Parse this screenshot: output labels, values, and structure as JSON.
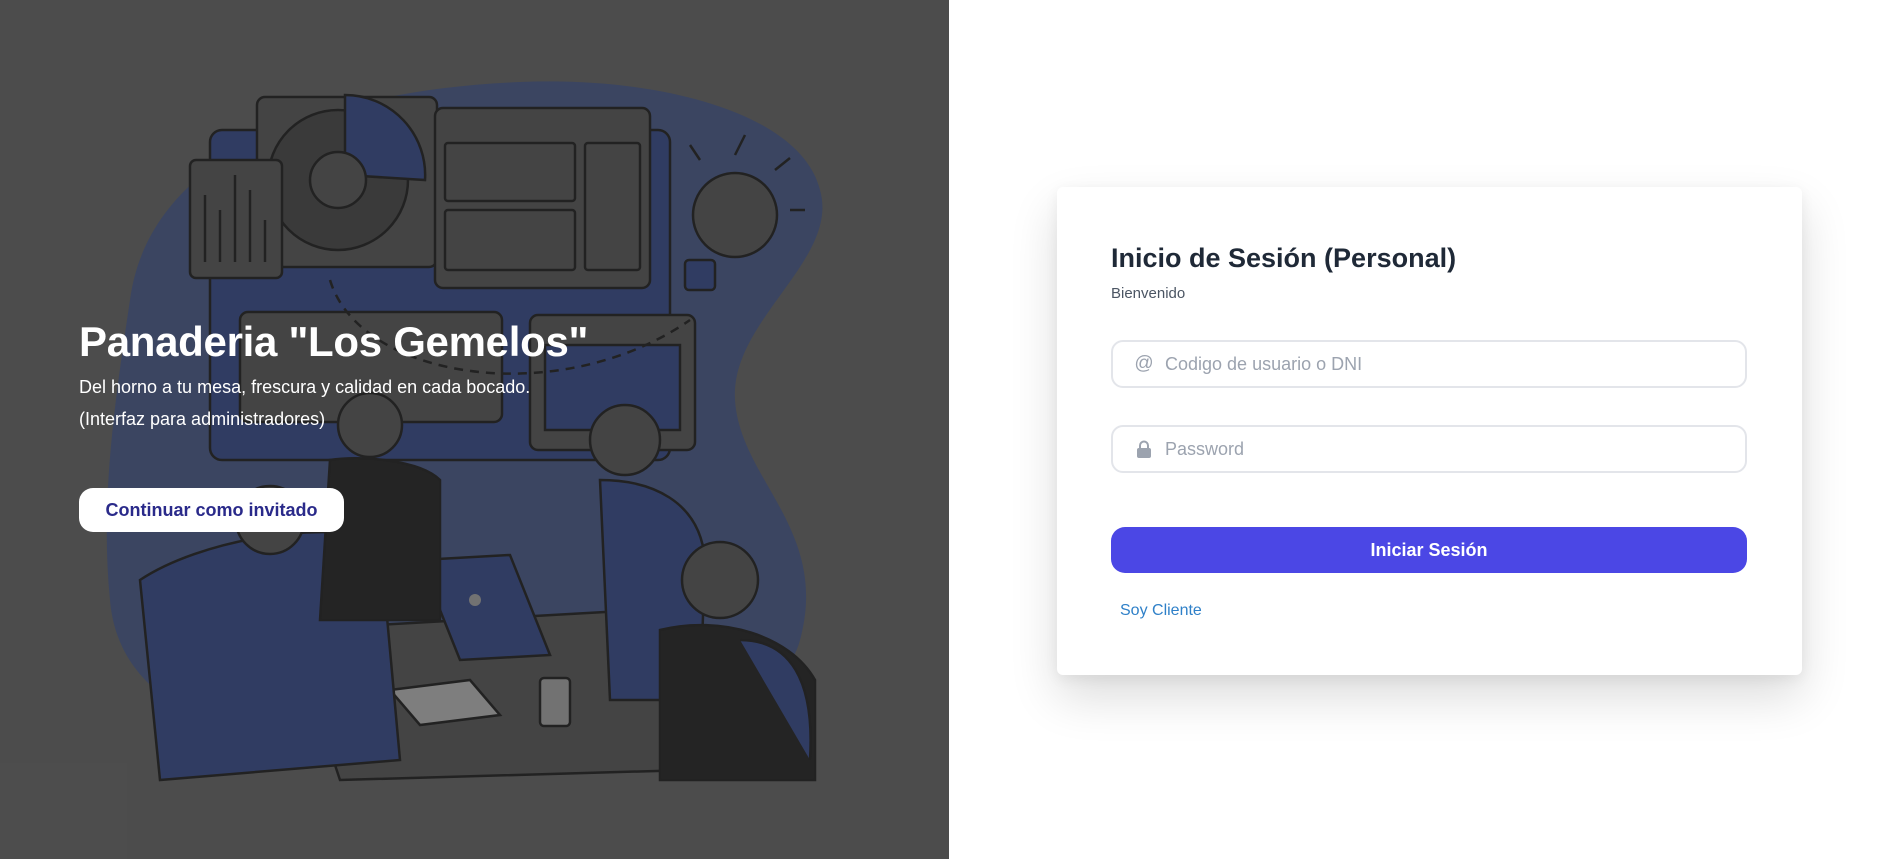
{
  "brand": {
    "title": "Panaderia \"Los Gemelos\"",
    "tagline": "Del horno a tu mesa, frescura y calidad en cada bocado.",
    "note": "(Interfaz para administradores)",
    "guest_button": "Continuar como invitado"
  },
  "login": {
    "title": "Inicio de Sesión (Personal)",
    "subtitle": "Bienvenido",
    "user_placeholder": "Codigo de usuario o DNI",
    "user_icon": "at-icon",
    "password_placeholder": "Password",
    "password_icon": "lock-icon",
    "submit_label": "Iniciar Sesión",
    "client_link": "Soy Cliente"
  },
  "colors": {
    "left_panel_bg": "#555555",
    "illustration_accent": "#2f3f73",
    "primary_button": "#4b47e5",
    "link": "#2f80c8",
    "guest_button_text": "#2a2a8a"
  }
}
